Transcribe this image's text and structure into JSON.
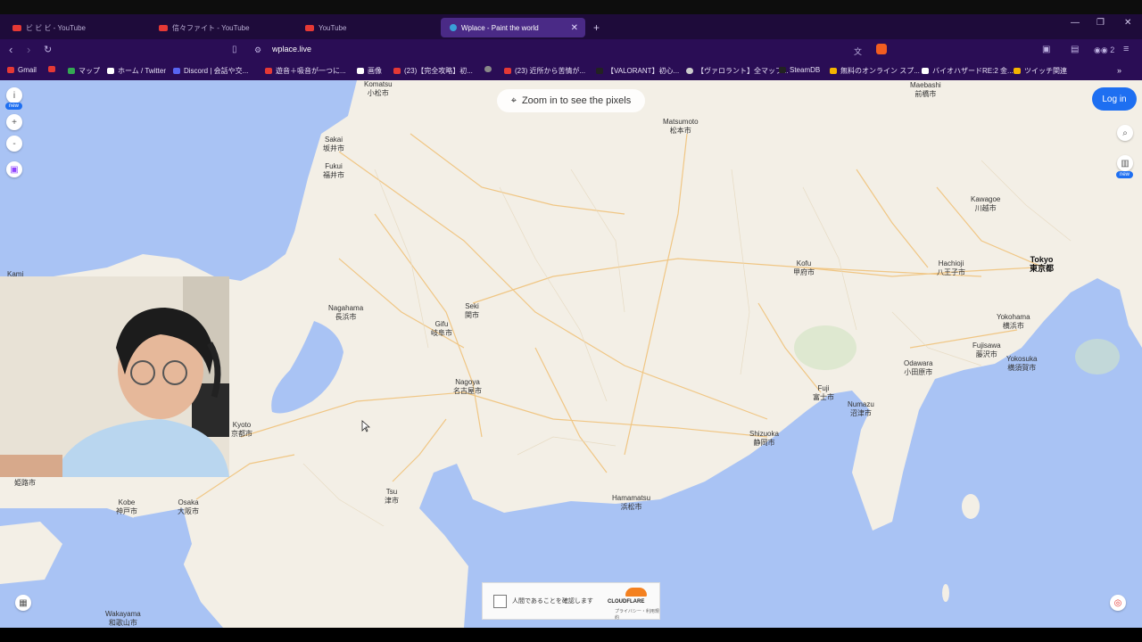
{
  "browser": {
    "tabs": [
      {
        "label": "ビ ビ ビ - YouTube",
        "color": "#e53935"
      },
      {
        "label": "信々ファイト - YouTube",
        "color": "#e53935"
      },
      {
        "label": "YouTube",
        "color": "#e53935"
      },
      {
        "label": "Wplace - Paint the world",
        "color": "#3aa0d8"
      }
    ],
    "new_tab": "+",
    "url": "wplace.live",
    "bookmarks": [
      {
        "label": "Gmail",
        "color": "#e53935"
      },
      {
        "label": "",
        "color": "#e53935"
      },
      {
        "label": "マップ",
        "color": "#34a853"
      },
      {
        "label": "ホーム / Twitter",
        "color": "#ffffff"
      },
      {
        "label": "Discord | 会話や交...",
        "color": "#5865f2"
      },
      {
        "label": "遊音＋吸音が一つに...",
        "color": "#e53935"
      },
      {
        "label": "画像",
        "color": "#ffffff"
      },
      {
        "label": "(23)【完全攻略】初...",
        "color": "#e53935"
      },
      {
        "label": "",
        "color": "#888888"
      },
      {
        "label": "(23) 近所から苦情が...",
        "color": "#e53935"
      },
      {
        "label": "【VALORANT】初心...",
        "color": "#222222"
      },
      {
        "label": "【ヴァロラント】全マップ...",
        "color": "#cccccc"
      },
      {
        "label": "SteamDB",
        "color": "#222222"
      },
      {
        "label": "無料のオンライン スプ...",
        "color": "#f4b400"
      },
      {
        "label": "バイオハザードRE:2 金...",
        "color": "#ffffff"
      },
      {
        "label": "ツイッチ関連",
        "color": "#f4b400"
      }
    ]
  },
  "app": {
    "zoom_hint": "Zoom in to see the pixels",
    "login": "Log in",
    "new_badge": "new",
    "captcha_text": "人間であることを確認します",
    "captcha_brand": "CLOUDFLARE",
    "captcha_links": "プライバシー・利用規約"
  },
  "cities": [
    {
      "en": "Komatsu",
      "jp": "小松市"
    },
    {
      "en": "Sakai",
      "jp": "坂井市"
    },
    {
      "en": "Fukui",
      "jp": "福井市"
    },
    {
      "en": "Matsumoto",
      "jp": "松本市"
    },
    {
      "en": "Maebashi",
      "jp": "前橋市"
    },
    {
      "en": "Kawagoe",
      "jp": "川越市"
    },
    {
      "en": "Tokyo",
      "jp": "東京都"
    },
    {
      "en": "Hachioji",
      "jp": "八王子市"
    },
    {
      "en": "Kofu",
      "jp": "甲府市"
    },
    {
      "en": "Nagahama",
      "jp": "長浜市"
    },
    {
      "en": "Seki",
      "jp": "関市"
    },
    {
      "en": "Gifu",
      "jp": "岐阜市"
    },
    {
      "en": "Yokohama",
      "jp": "横浜市"
    },
    {
      "en": "Fujisawa",
      "jp": "藤沢市"
    },
    {
      "en": "Yokosuka",
      "jp": "横須賀市"
    },
    {
      "en": "Odawara",
      "jp": "小田原市"
    },
    {
      "en": "Nagoya",
      "jp": "名古屋市"
    },
    {
      "en": "Fuji",
      "jp": "富士市"
    },
    {
      "en": "Numazu",
      "jp": "沼津市"
    },
    {
      "en": "Kyoto",
      "jp": "京都市"
    },
    {
      "en": "Shizuoka",
      "jp": "静岡市"
    },
    {
      "en": "",
      "jp": "姫路市"
    },
    {
      "en": "Tsu",
      "jp": "津市"
    },
    {
      "en": "Hamamatsu",
      "jp": "浜松市"
    },
    {
      "en": "Kobe",
      "jp": "神戸市"
    },
    {
      "en": "Osaka",
      "jp": "大阪市"
    },
    {
      "en": "Wakayama",
      "jp": "和歌山市"
    },
    {
      "en": "Kami",
      "jp": ""
    }
  ],
  "colors": {
    "accent": "#1e6ff1",
    "sea": "#a9c3f4",
    "land": "#f3efe6",
    "browser_bg": "#2a0d55"
  }
}
